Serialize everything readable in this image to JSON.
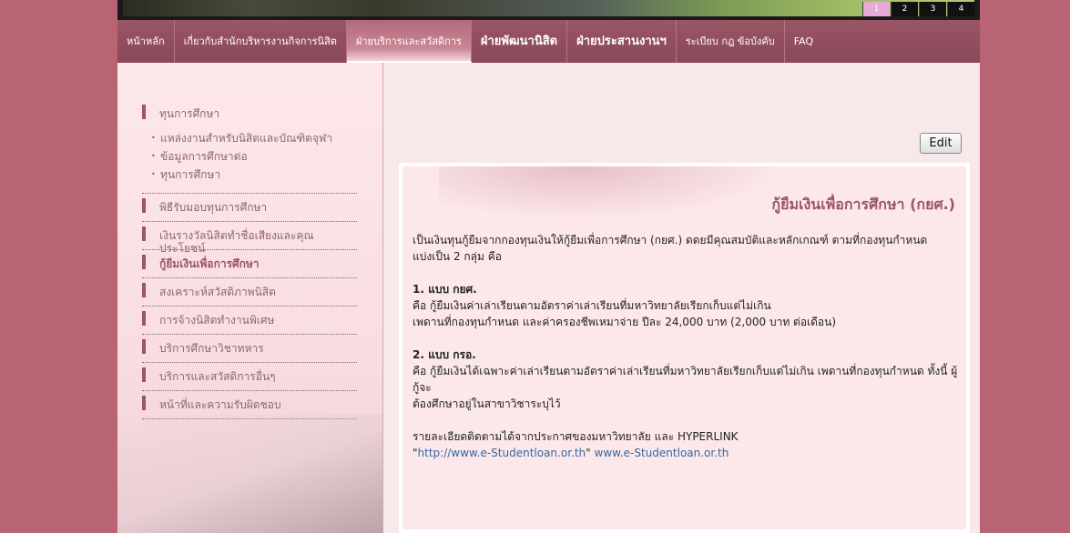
{
  "banner": {
    "slides": [
      "1",
      "2",
      "3",
      "4"
    ],
    "active_slide": "1"
  },
  "nav": {
    "items": [
      {
        "label": "หน้าหลัก",
        "style": "normal"
      },
      {
        "label": "เกี่ยวกับสำนักบริหารงานกิจการนิสิต",
        "style": "normal"
      },
      {
        "label": "ฝ่ายบริการและสวัสดิการ",
        "style": "active"
      },
      {
        "label": "ฝ่ายพัฒนานิสิต",
        "style": "big"
      },
      {
        "label": "ฝ่ายประสานงานฯ",
        "style": "big"
      },
      {
        "label": "ระเบียบ กฎ ข้อบังคับ",
        "style": "normal"
      },
      {
        "label": "FAQ",
        "style": "normal"
      }
    ]
  },
  "sidebar": {
    "first": "ทุนการศึกษา",
    "sub_items": [
      "แหล่งงานสำหรับนิสิตและบัณฑิตจุฬา",
      "ข้อมูลการศึกษาต่อ",
      "ทุนการศึกษา"
    ],
    "items": [
      {
        "label": "พิธีรับมอบทุนการศึกษา"
      },
      {
        "label": "เงินรางวัลนิสิตทำชื่อเสียงและคุณประโยชน์"
      },
      {
        "label": "กู้ยืมเงินเพื่อการศึกษา",
        "active": true
      },
      {
        "label": "สงเคราะห์สวัสดิภาพนิสิต"
      },
      {
        "label": "การจ้างนิสิตทำงานพิเศษ"
      },
      {
        "label": "บริการศึกษาวิชาทหาร"
      },
      {
        "label": "บริการและสวัสดิการอื่นๆ"
      },
      {
        "label": "หน้าที่และความรับผิดชอบ"
      }
    ]
  },
  "edit_label": "Edit",
  "content": {
    "title": "กู้ยืมเงินเพื่อการศึกษา (กยศ.)",
    "intro_1": "เป็นเงินทุนกู้ยืมจากกองทุนเงินให้กู้ยืมเพื่อการศึกษา (กยศ.) ดดยมีคุณสมบัติและหลักเกณฑ์ ตามที่กองทุนกำหนด",
    "intro_2": "แบ่งเป็น 2 กลุ่ม คือ",
    "type1_heading": "1. แบบ กยศ.",
    "type1_line1": "คือ กู้ยืมเงินค่าเล่าเรียนตามอัตราค่าเล่าเรียนที่มหาวิทยาลัยเรียกเก็บแต่ไม่เกิน",
    "type1_line2": "เพดานที่กองทุนกำหนด และค่าครองชีพเหมาจ่าย ปีละ 24,000 บาท (2,000 บาท ต่อเดือน)",
    "type2_heading": "2. แบบ กรอ.",
    "type2_line1": "คือ กู้ยืมเงินได้เฉพาะค่าเล่าเรียนตามอัตราค่าเล่าเรียนที่มหาวิทยาลัยเรียกเก็บแต่ไม่เกิน เพดานที่กองทุนกำหนด ทั้งนี้ ผู้กู้จะ",
    "type2_line2": "ต้องศึกษาอยู่ในสาขาวิชาระบุไว้",
    "more_info": "รายละเอียดติดตามได้จากประกาศของมหาวิทยาลัย และ HYPERLINK",
    "link_quote_open": "\"",
    "link_url": "http://www.e-Studentloan.or.th",
    "link_quote_close": "\" ",
    "link_text": "www.e-Studentloan.or.th"
  },
  "colors": {
    "accent": "#9a5566",
    "background": "#b86474",
    "link": "#3466a0"
  }
}
